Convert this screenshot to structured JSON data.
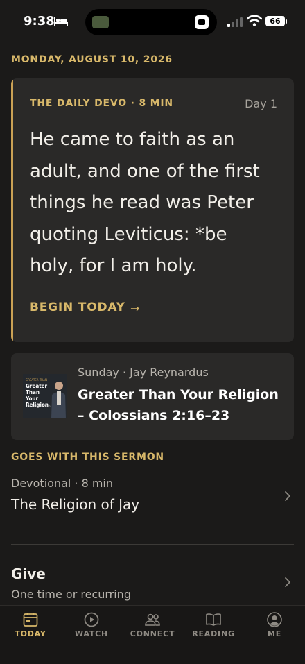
{
  "status_bar": {
    "time": "9:38",
    "battery": "66"
  },
  "date_header": "MONDAY, AUGUST 10, 2026",
  "devo_card": {
    "label": "THE DAILY DEVO · 8 MIN",
    "day": "Day 1",
    "quote": "He came to faith as an adult, and one of the first things he read was Peter quoting Leviticus: *be holy, for I am holy.",
    "cta": "BEGIN TODAY",
    "cta_arrow": "→"
  },
  "sermon_card": {
    "meta": "Sunday · Jay Reynardus",
    "title": "Greater Than Your Religion – Colossians 2:16–23",
    "thumbnail": {
      "small_label": "GREATER THAN",
      "title": "Greater Than Your Religion",
      "subtitle": "COLOSSIANS 2:16-23"
    }
  },
  "goes_with": {
    "header": "GOES WITH THIS SERMON",
    "meta": "Devotional · 8 min",
    "title": "The Religion of Jay"
  },
  "give": {
    "title": "Give",
    "subtitle": "One time or recurring"
  },
  "tabs": [
    {
      "label": "TODAY",
      "icon": "calendar-icon",
      "active": true
    },
    {
      "label": "WATCH",
      "icon": "play-icon",
      "active": false
    },
    {
      "label": "CONNECT",
      "icon": "people-icon",
      "active": false
    },
    {
      "label": "READING",
      "icon": "book-icon",
      "active": false
    },
    {
      "label": "ME",
      "icon": "profile-icon",
      "active": false
    }
  ],
  "colors": {
    "accent": "#d8b86a",
    "background": "#1b1a19",
    "card": "#2a2928"
  }
}
